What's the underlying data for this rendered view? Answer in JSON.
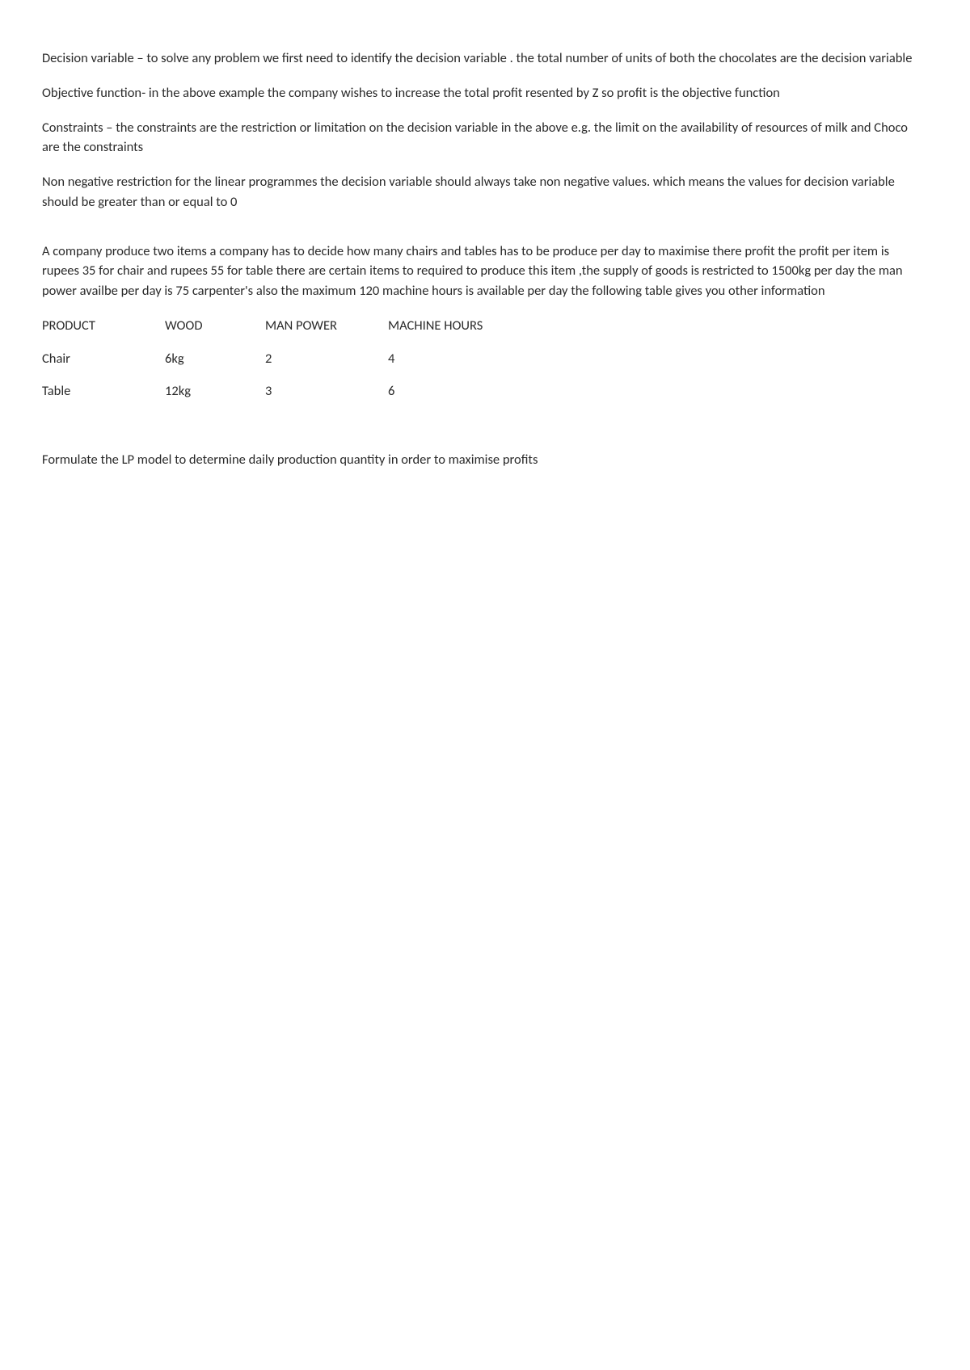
{
  "paragraphs": {
    "decision_variable": "Decision variable – to solve any problem we first need to identify the decision variable . the total number of units of both the chocolates are the decision variable",
    "objective_function": "Objective function- in the above example the company wishes to increase the total profit resented by Z so profit is the objective function",
    "constraints": "Constraints – the constraints are the restriction or limitation on the decision variable in the above e.g. the limit on the availability of resources of milk and Choco are the constraints",
    "non_negative": "Non negative restriction for the linear programmes the decision variable should always take non negative values. which means the values for decision variable should be greater than or equal to 0",
    "problem_statement": "A company produce two items a company has to decide how many chairs and tables has to be produce per day to maximise there profit the profit per item is rupees 35 for chair and rupees 55 for table there are certain items to required to produce this item ,the supply of goods is restricted to 1500kg per day the man power availbe  per day is 75 carpenter's also the maximum 120 machine hours is available per day the following table gives you other information",
    "formulate": "Formulate the LP model to determine daily production quantity in order to maximise profits"
  },
  "table": {
    "headers": {
      "product": "PRODUCT",
      "wood": "WOOD",
      "manpower": "MAN POWER",
      "machine": "MACHINE HOURS"
    },
    "rows": [
      {
        "product": "Chair",
        "wood": "6kg",
        "manpower": "2",
        "machine": "4"
      },
      {
        "product": "Table",
        "wood": "12kg",
        "manpower": "3",
        "machine": "6"
      }
    ]
  }
}
